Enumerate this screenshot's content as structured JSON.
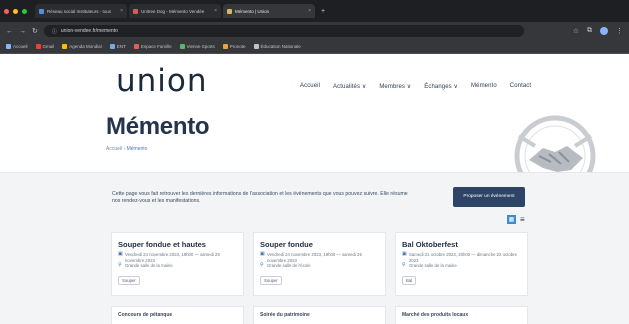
{
  "browser": {
    "tabs": [
      {
        "label": "Réseau social Instituteurs - tous"
      },
      {
        "label": "Unitree Dog - Mémento Vendée"
      },
      {
        "label": "Mémento | Union"
      }
    ],
    "new_tab_label": "+",
    "url": "union-vendee.fr/memento",
    "bookmarks": [
      {
        "label": "Accueil"
      },
      {
        "label": "Gmail"
      },
      {
        "label": "Agenda Mondial"
      },
      {
        "label": "ENT"
      },
      {
        "label": "Espace Famille"
      },
      {
        "label": "Vienne Sports"
      },
      {
        "label": "Pronote"
      },
      {
        "label": "Éducation Nationale"
      }
    ]
  },
  "site": {
    "logo_text": "union",
    "nav": [
      "Accueil",
      "Actualités ∨",
      "Membres ∨",
      "Échanges ∨",
      "Mémento",
      "Contact"
    ]
  },
  "page": {
    "title": "Mémento",
    "breadcrumb_home": "Accueil",
    "breadcrumb_sep": " › ",
    "breadcrumb_current": "Mémento",
    "intro": "Cette page vous fait retrouver les dernières informations de l'association et les événements que vous pouvez suivre. Elle résume nos rendez-vous et les manifestations.",
    "cta_label": "Proposer un événement",
    "view_grid_icon": "▦",
    "view_list_icon": "≡"
  },
  "cards": [
    {
      "title": "Souper fondue et hautes",
      "date": "Vendredi 24 novembre 2023, 19h00 — samedi 25 novembre 2023",
      "place": "Grande salle de la mairie",
      "tag": "Souper"
    },
    {
      "title": "Souper fondue",
      "date": "Vendredi 24 novembre 2023, 19h00 — samedi 25 novembre 2023",
      "place": "Grande salle de l'école",
      "tag": "Souper"
    },
    {
      "title": "Bal Oktoberfest",
      "date": "Samedi 21 octobre 2023, 20h00 — dimanche 22 octobre 2023",
      "place": "Grande salle de la mairie",
      "tag": "Bal"
    }
  ],
  "cards_next_row": [
    {
      "title": "Concours de pétanque"
    },
    {
      "title": "Soirée du patrimoine"
    },
    {
      "title": "Marché des produits locaux"
    }
  ]
}
